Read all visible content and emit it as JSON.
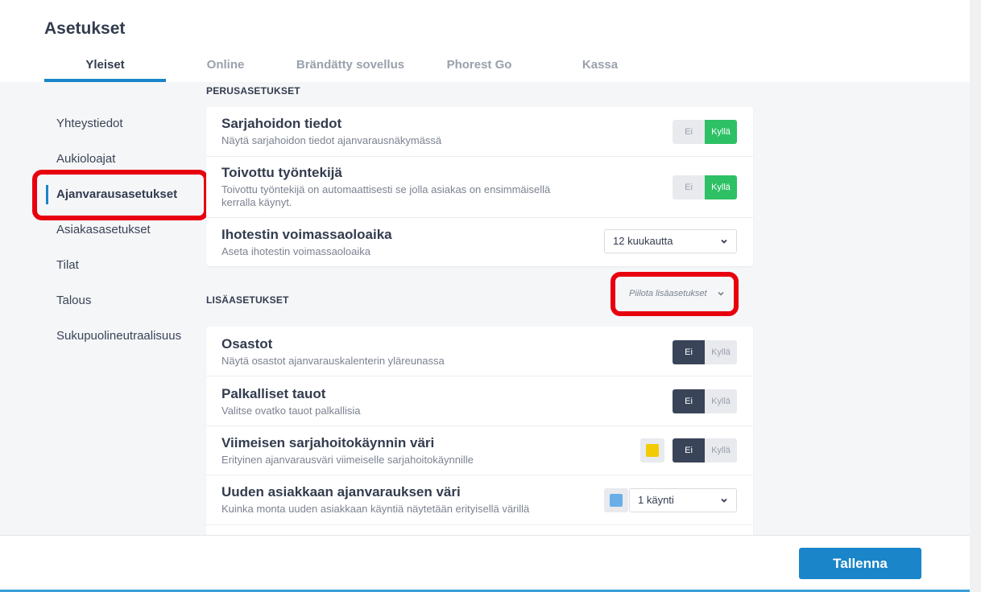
{
  "page": {
    "title": "Asetukset"
  },
  "tabs": [
    {
      "label": "Yleiset",
      "active": true
    },
    {
      "label": "Online"
    },
    {
      "label": "Brändätty sovellus"
    },
    {
      "label": "Phorest Go"
    },
    {
      "label": "Kassa"
    }
  ],
  "sidebar": {
    "items": [
      {
        "label": "Yhteystiedot"
      },
      {
        "label": "Aukioloajat"
      },
      {
        "label": "Ajanvarausasetukset",
        "active": true
      },
      {
        "label": "Asiakasasetukset"
      },
      {
        "label": "Tilat"
      },
      {
        "label": "Talous"
      },
      {
        "label": "Sukupuolineutraalisuus"
      }
    ]
  },
  "basic": {
    "section_title": "PERUSASETUKSET",
    "rows": [
      {
        "title": "Sarjahoidon tiedot",
        "desc": "Näytä sarjahoidon tiedot ajanvarausnäkymässä",
        "no": "Ei",
        "yes": "Kyllä",
        "value": "yes"
      },
      {
        "title": "Toivottu työntekijä",
        "desc": "Toivottu työntekijä on automaattisesti se jolla asiakas on ensimmäisellä kerralla käynyt.",
        "no": "Ei",
        "yes": "Kyllä",
        "value": "yes"
      },
      {
        "title": "Ihotestin voimassaoloaika",
        "desc": "Aseta ihotestin voimassaoloaika",
        "select_value": "12 kuukautta"
      }
    ]
  },
  "advanced": {
    "section_title": "LISÄASETUKSET",
    "collapse_label": "Piilota lisäasetukset",
    "rows": [
      {
        "title": "Osastot",
        "desc": "Näytä osastot ajanvarauskalenterin yläreunassa",
        "no": "Ei",
        "yes": "Kyllä",
        "value": "no"
      },
      {
        "title": "Palkalliset tauot",
        "desc": "Valitse ovatko tauot palkallisia",
        "no": "Ei",
        "yes": "Kyllä",
        "value": "no"
      },
      {
        "title": "Viimeisen sarjahoitokäynnin väri",
        "desc": "Erityinen ajanvarausväri viimeiselle sarjahoitokäynnille",
        "no": "Ei",
        "yes": "Kyllä",
        "value": "no",
        "color": "#f2cb05"
      },
      {
        "title": "Uuden asiakkaan ajanvarauksen väri",
        "desc": "Kuinka monta uuden asiakkaan käyntiä näytetään erityisellä värillä",
        "select_value": "1 käynti",
        "color": "#6aaee8"
      }
    ]
  },
  "footer": {
    "save_label": "Tallenna"
  },
  "colors": {
    "accent": "#1a85c8",
    "toggle_yes": "#2dc064",
    "toggle_selected": "#3a4458",
    "highlight": "#e8000f"
  }
}
